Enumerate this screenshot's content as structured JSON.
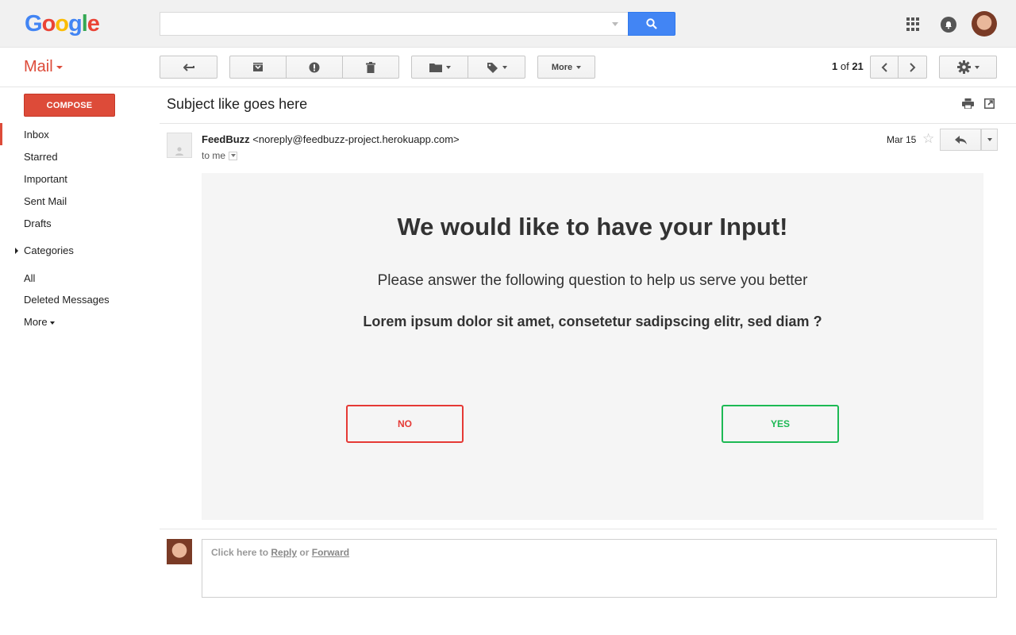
{
  "header": {
    "logo_letters": [
      "G",
      "o",
      "o",
      "g",
      "l",
      "e"
    ],
    "search": {
      "value": "",
      "placeholder": ""
    }
  },
  "toolbar": {
    "app_label": "Mail",
    "more_label": "More",
    "pager": {
      "current": "1",
      "of": "of",
      "total": "21"
    }
  },
  "sidebar": {
    "compose_label": "COMPOSE",
    "items": [
      {
        "label": "Inbox",
        "active": true
      },
      {
        "label": "Starred"
      },
      {
        "label": "Important"
      },
      {
        "label": "Sent Mail"
      },
      {
        "label": "Drafts"
      },
      {
        "label": "Categories"
      },
      {
        "label": "All"
      },
      {
        "label": "Deleted Messages"
      },
      {
        "label": "More"
      }
    ]
  },
  "message": {
    "subject": "Subject like goes here",
    "sender_name": "FeedBuzz",
    "sender_email": "<noreply@feedbuzz-project.herokuapp.com>",
    "to": "to me",
    "date": "Mar 15"
  },
  "email_body": {
    "title": "We would like to have your Input!",
    "subtitle": "Please answer the following question to help us serve you better",
    "question": "Lorem ipsum dolor sit amet, consetetur sadipscing elitr, sed diam ?",
    "no_label": "NO",
    "yes_label": "YES"
  },
  "reply_prompt": {
    "prefix": "Click here to",
    "reply": "Reply",
    "or": "or",
    "forward": "Forward"
  },
  "colors": {
    "brand_red": "#dd4b39",
    "search_blue": "#4285f4",
    "no_red": "#e53935",
    "yes_green": "#1db954"
  }
}
